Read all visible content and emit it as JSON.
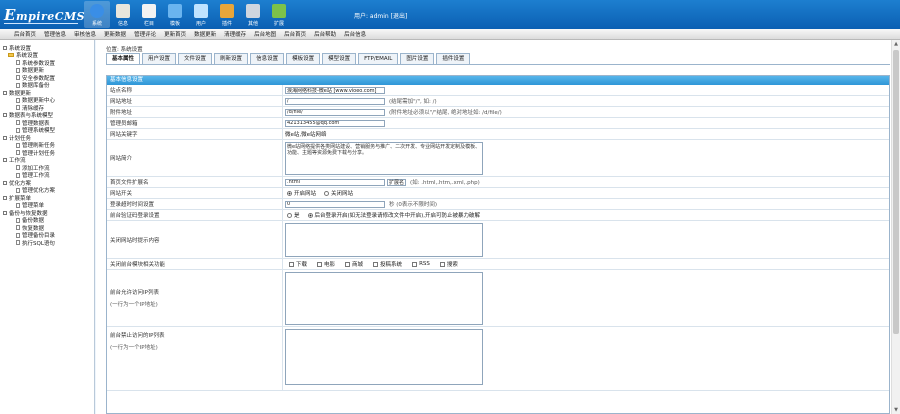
{
  "app": {
    "logo_main": "E",
    "logo_rest": "mpireCMS"
  },
  "topnav": [
    {
      "label": "系统",
      "icon": "system-icon",
      "color": "#3a8ee6"
    },
    {
      "label": "信息",
      "icon": "info-icon",
      "color": "#e9e6dc"
    },
    {
      "label": "栏目",
      "icon": "column-icon",
      "color": "#f2f2f2"
    },
    {
      "label": "模板",
      "icon": "template-icon",
      "color": "#6ab4ef"
    },
    {
      "label": "用户",
      "icon": "user-icon",
      "color": "#bfe3ff"
    },
    {
      "label": "插件",
      "icon": "plugin-icon",
      "color": "#e8a63a"
    },
    {
      "label": "其他",
      "icon": "gear-icon",
      "color": "#cfd6df"
    },
    {
      "label": "扩展",
      "icon": "extend-icon",
      "color": "#7cc24a"
    }
  ],
  "user_info": "用户: admin [退出]",
  "menubar": [
    "后台首页",
    "管理信息",
    "审核信息",
    "更新数据",
    "管理评论",
    "更新首页",
    "数据更新",
    "清理缓存",
    "后台地图",
    "后台首页",
    "后台帮助",
    "后台信息"
  ],
  "sidebar": [
    {
      "label": "系统设置",
      "level": 0,
      "kind": "box"
    },
    {
      "label": "系统设置",
      "level": 1,
      "kind": "folder"
    },
    {
      "label": "系统参数设置",
      "level": 2,
      "kind": "doc"
    },
    {
      "label": "数据更新",
      "level": 2,
      "kind": "doc"
    },
    {
      "label": "安全参数配置",
      "level": 2,
      "kind": "doc"
    },
    {
      "label": "数据库备份",
      "level": 2,
      "kind": "doc"
    },
    {
      "label": "数据更新",
      "level": 0,
      "kind": "box"
    },
    {
      "label": "数据更新中心",
      "level": 2,
      "kind": "doc"
    },
    {
      "label": "清除缓存",
      "level": 2,
      "kind": "doc"
    },
    {
      "label": "数据表与系统模型",
      "level": 0,
      "kind": "box"
    },
    {
      "label": "管理数据表",
      "level": 2,
      "kind": "doc"
    },
    {
      "label": "管理系统模型",
      "level": 2,
      "kind": "doc"
    },
    {
      "label": "计划任务",
      "level": 0,
      "kind": "box"
    },
    {
      "label": "管理刷新任务",
      "level": 2,
      "kind": "doc"
    },
    {
      "label": "管理计划任务",
      "level": 2,
      "kind": "doc"
    },
    {
      "label": "工作流",
      "level": 0,
      "kind": "box"
    },
    {
      "label": "添加工作流",
      "level": 2,
      "kind": "doc"
    },
    {
      "label": "管理工作流",
      "level": 2,
      "kind": "doc"
    },
    {
      "label": "优化方案",
      "level": 0,
      "kind": "box"
    },
    {
      "label": "管理优化方案",
      "level": 2,
      "kind": "doc"
    },
    {
      "label": "扩展菜单",
      "level": 0,
      "kind": "box"
    },
    {
      "label": "管理菜单",
      "level": 2,
      "kind": "doc"
    },
    {
      "label": "备份与恢复数据",
      "level": 0,
      "kind": "box"
    },
    {
      "label": "备份数据",
      "level": 2,
      "kind": "doc"
    },
    {
      "label": "恢复数据",
      "level": 2,
      "kind": "doc"
    },
    {
      "label": "管理备份目录",
      "level": 2,
      "kind": "doc"
    },
    {
      "label": "执行SQL语句",
      "level": 2,
      "kind": "doc"
    }
  ],
  "breadcrumb": "位置: 系统设置",
  "tabs": [
    "基本属性",
    "用户设置",
    "文件设置",
    "刷新设置",
    "信息设置",
    "模板设置",
    "模型设置",
    "FTP/EMAIL",
    "图片设置",
    "插件设置"
  ],
  "section_title": "基本信息设置",
  "form": {
    "site_name": {
      "label": "站点名称",
      "value": "浪海网络科技-微e站 [www.vioeo.com]"
    },
    "site_url": {
      "label": "网站地址",
      "value": "/",
      "hint": "(结尾需加\"/\", 如: /)"
    },
    "attach_url": {
      "label": "附件地址",
      "value": "/d/file/",
      "hint": "(附件地址必须以\"/\"结尾, 绝对地址如: /d/file/)"
    },
    "admin_email": {
      "label": "管理员邮箱",
      "value": "421313455@qq.com"
    },
    "site_keywords": {
      "label": "网站关键字",
      "value": "微e站,微e站网络"
    },
    "site_desc": {
      "label": "网站简介",
      "value": "微e站网络提供各类网站建设、营销服务与推广、二次开发、专业网站开发定制及模板、功能、主题等资源免费下载与分享。"
    },
    "index_ext": {
      "label": "首页文件扩展名",
      "value": ".html",
      "select": "扩展名",
      "hint": "(如: .html,.htm,.xml,.php)"
    },
    "open_site": {
      "label": "网站开关",
      "opt_on": "开启网站",
      "opt_off": "关闭网站"
    },
    "session_time": {
      "label": "登录超时时间设置",
      "value": "0",
      "hint": "秒 (0表示不限时间)"
    },
    "login_verify": {
      "label": "前台验证码登录设置",
      "opt_a": "是",
      "opt_b": "后台登录开启(如无法登录请修改文件中开启),开启可防止被暴力破解"
    },
    "close_tip": {
      "label": "关闭网站时提示内容",
      "value": ""
    },
    "close_modules": {
      "label": "关闭前台模块相关功能",
      "items": [
        "下载",
        "电影",
        "商城",
        "投稿系统",
        "RSS",
        "搜索"
      ]
    },
    "allowed_ips": {
      "label": "前台允许访问IP列表",
      "sub": "(一行为一个IP地址)",
      "value": ""
    },
    "denied_ips": {
      "label": "前台禁止访问的IP列表",
      "sub": "(一行为一个IP地址)",
      "value": ""
    }
  },
  "colors": {
    "topbar": "#0b5fb3",
    "section": "#2f96d7"
  }
}
